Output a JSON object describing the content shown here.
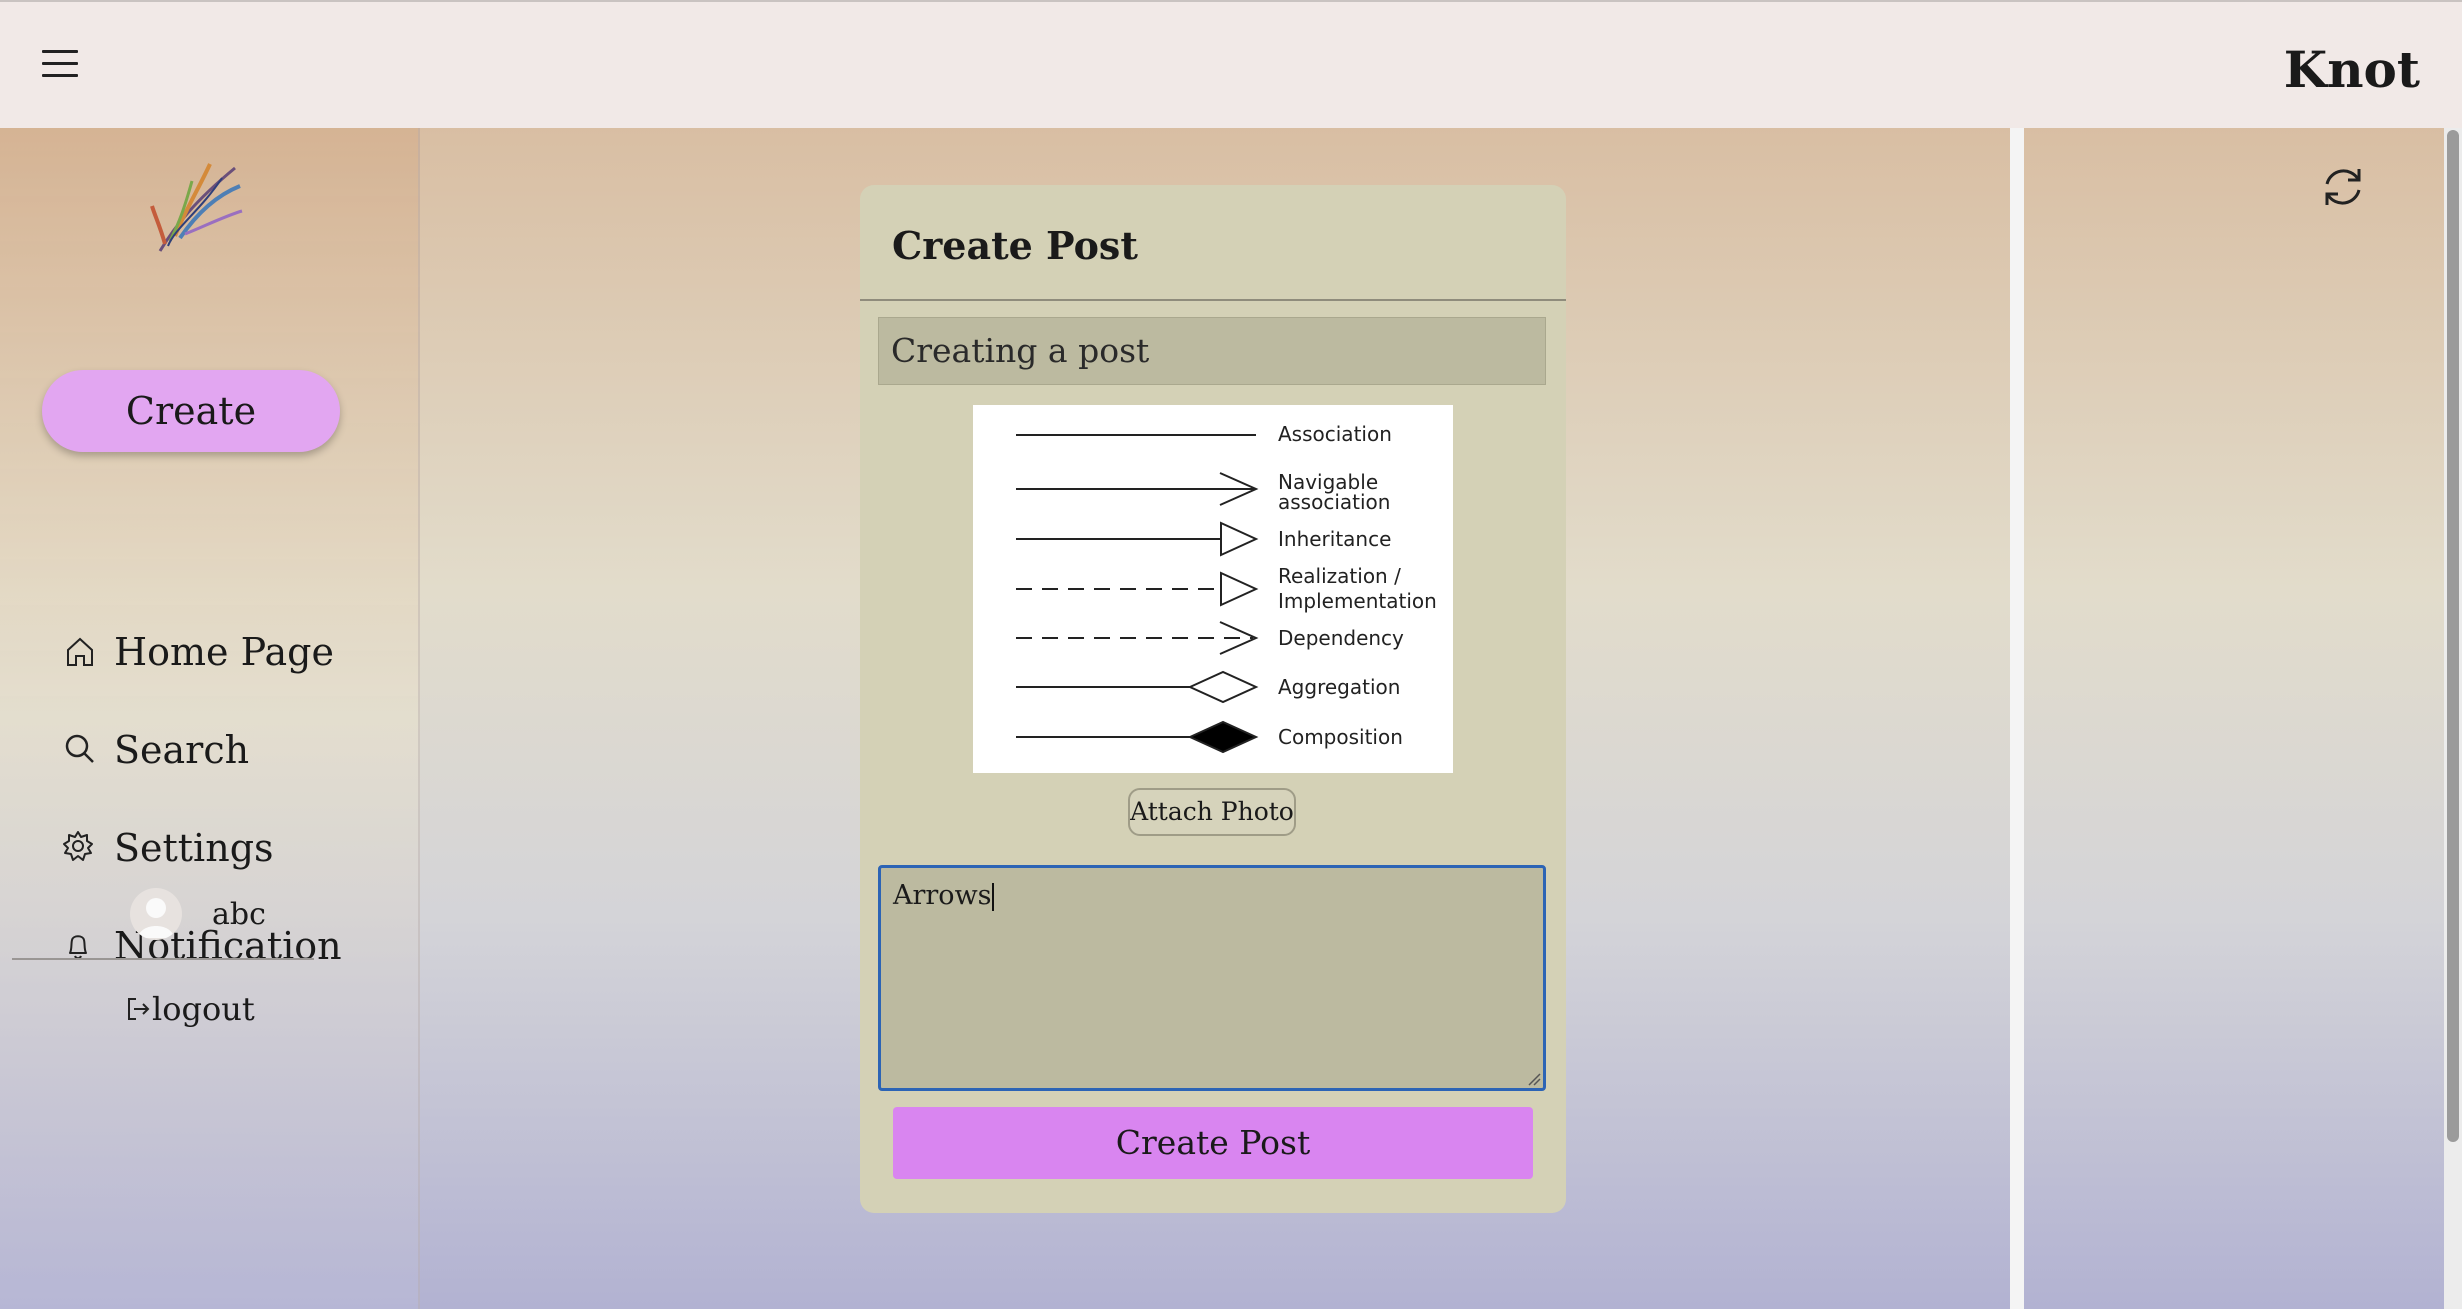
{
  "app": {
    "brand": "Knot"
  },
  "sidebar": {
    "create_label": "Create",
    "items": [
      {
        "label": "Home Page",
        "icon": "home-icon"
      },
      {
        "label": "Search",
        "icon": "search-icon"
      },
      {
        "label": "Settings",
        "icon": "gear-icon"
      },
      {
        "label": "Notification",
        "icon": "bell-icon"
      }
    ],
    "user": {
      "name": "abc"
    },
    "logout_label": "logout"
  },
  "post": {
    "heading": "Create Post",
    "title_value": "Creating a post",
    "attach_label": "Attach Photo",
    "body_value": "Arrows",
    "submit_label": "Create Post",
    "image_legend": [
      "Association",
      "Navigable",
      "association",
      "Inheritance",
      "Realization /",
      "Implementation",
      "Dependency",
      "Aggregation",
      "Composition"
    ]
  },
  "colors": {
    "accent": "#d985f0",
    "create_button": "#e2a6f1",
    "card": "#d4d1b6",
    "input": "#bcbaa0",
    "focus": "#2c64b5"
  }
}
